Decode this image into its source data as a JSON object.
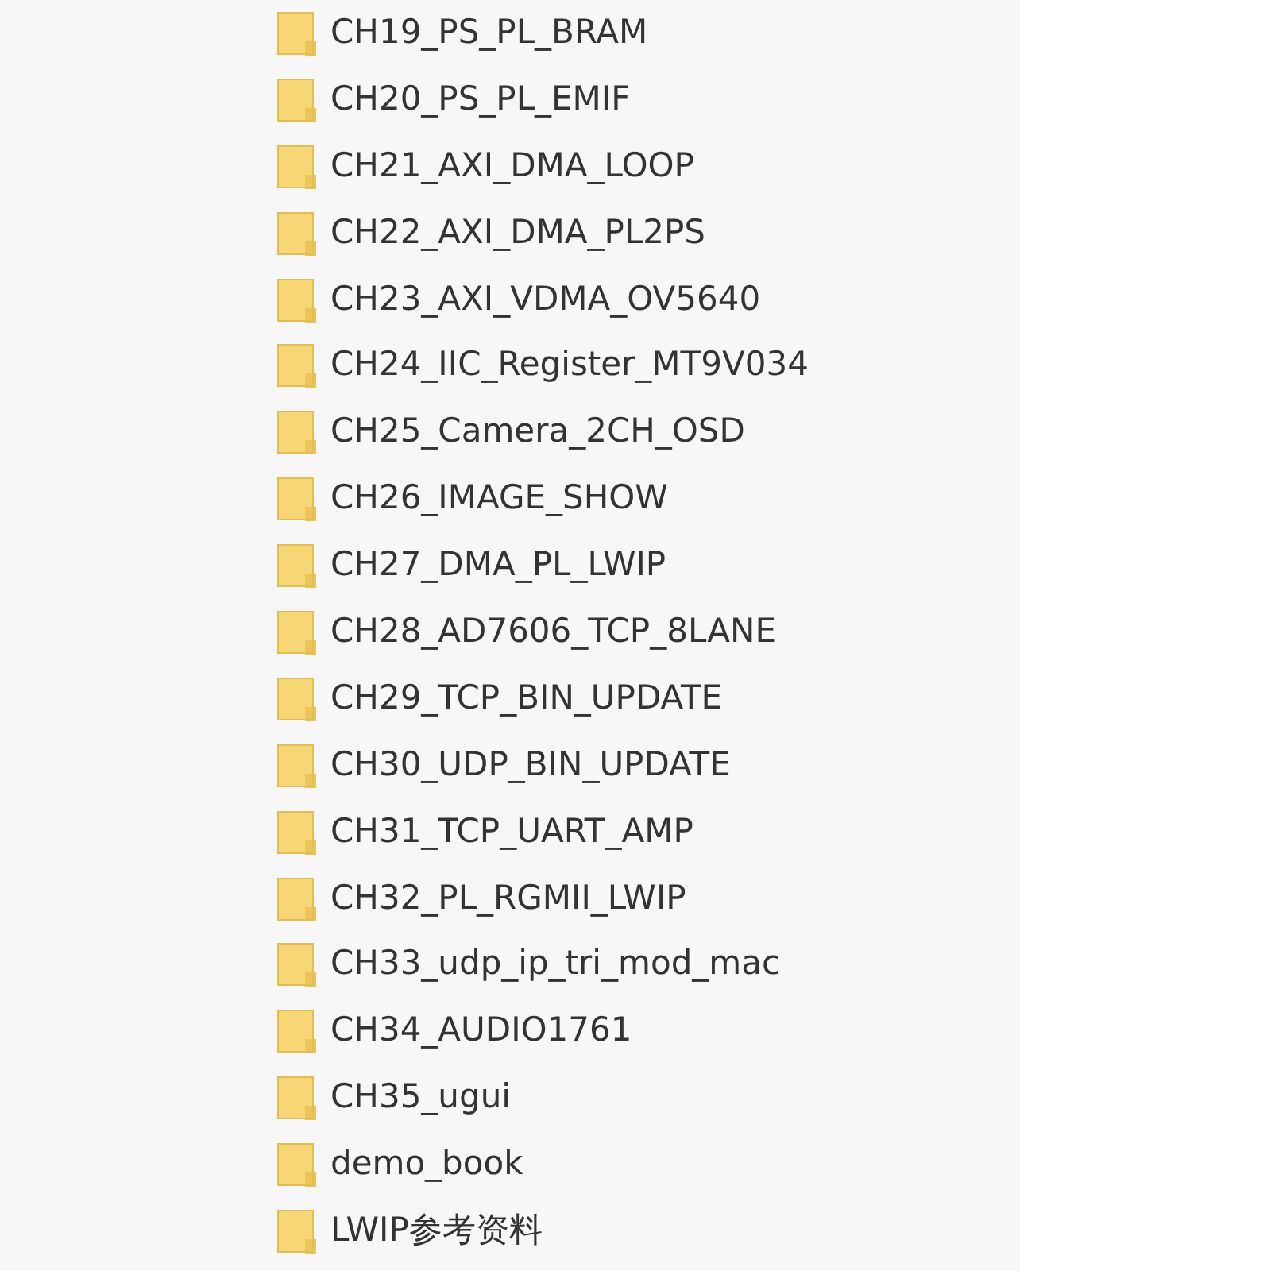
{
  "folders": [
    {
      "name": "CH19_PS_PL_BRAM"
    },
    {
      "name": "CH20_PS_PL_EMIF"
    },
    {
      "name": "CH21_AXI_DMA_LOOP"
    },
    {
      "name": "CH22_AXI_DMA_PL2PS"
    },
    {
      "name": "CH23_AXI_VDMA_OV5640"
    },
    {
      "name": "CH24_IIC_Register_MT9V034"
    },
    {
      "name": "CH25_Camera_2CH_OSD"
    },
    {
      "name": "CH26_IMAGE_SHOW"
    },
    {
      "name": "CH27_DMA_PL_LWIP"
    },
    {
      "name": "CH28_AD7606_TCP_8LANE"
    },
    {
      "name": "CH29_TCP_BIN_UPDATE"
    },
    {
      "name": "CH30_UDP_BIN_UPDATE"
    },
    {
      "name": "CH31_TCP_UART_AMP"
    },
    {
      "name": "CH32_PL_RGMII_LWIP"
    },
    {
      "name": "CH33_udp_ip_tri_mod_mac"
    },
    {
      "name": "CH34_AUDIO1761"
    },
    {
      "name": "CH35_ugui"
    },
    {
      "name": "demo_book"
    },
    {
      "name": "LWIP参考资料"
    }
  ]
}
